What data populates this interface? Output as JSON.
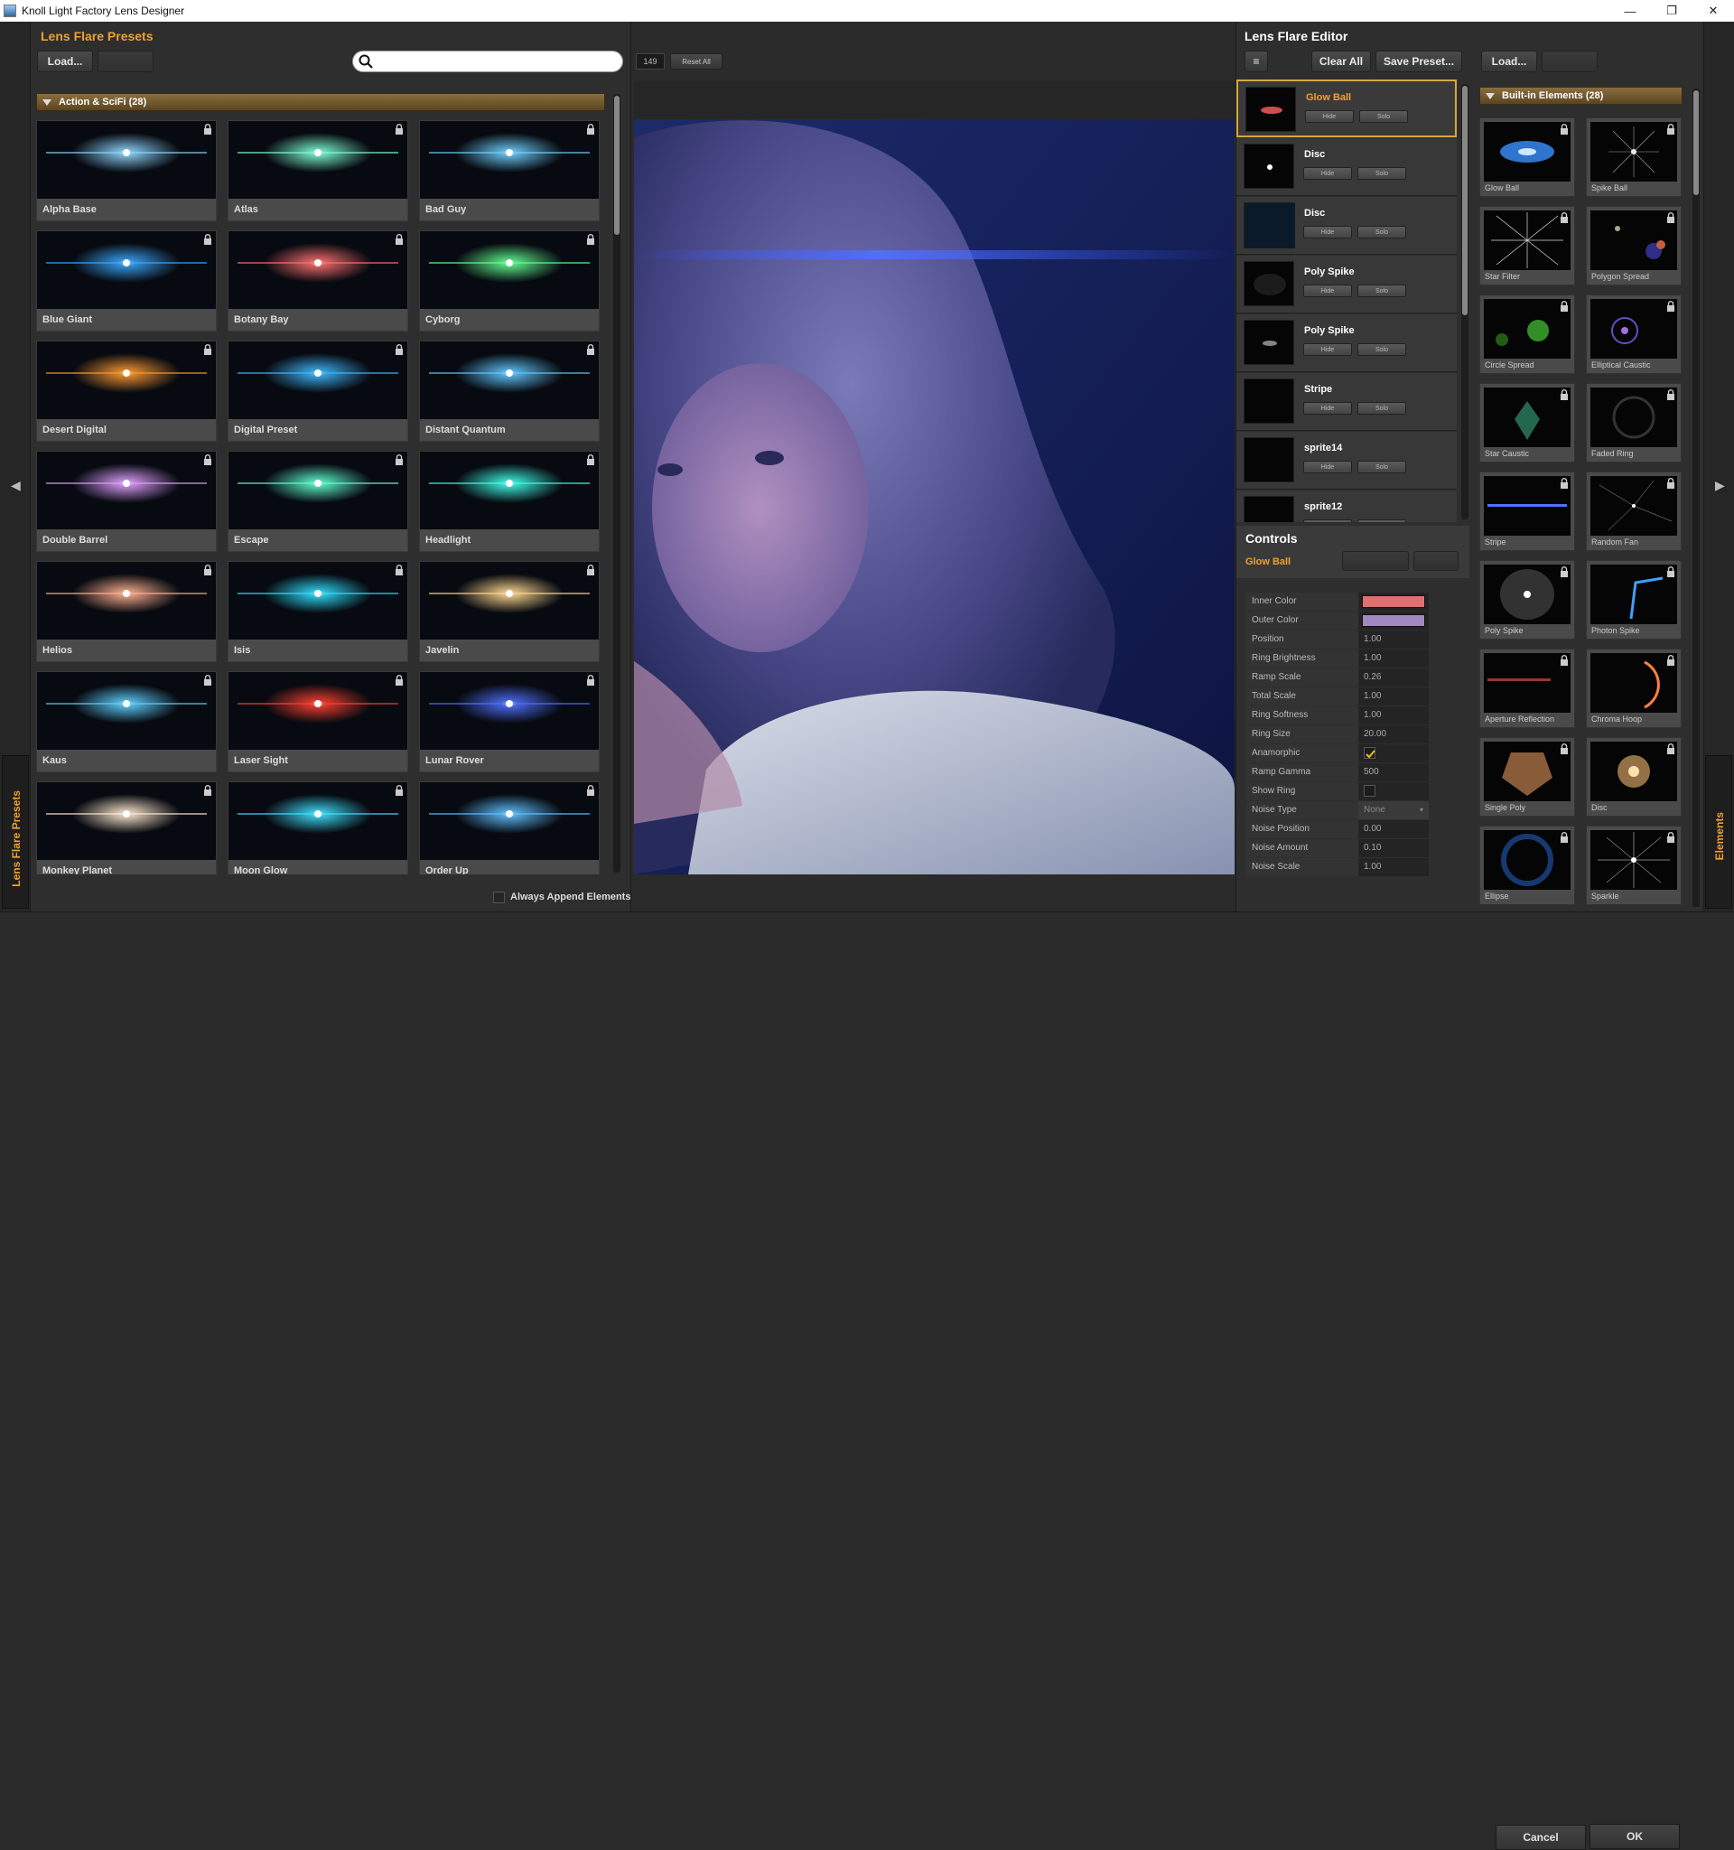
{
  "window": {
    "title": "Knoll Light Factory Lens Designer",
    "minimize": "—",
    "maximize": "❐",
    "close": "✕"
  },
  "left_panel": {
    "title": "Lens Flare Presets",
    "load_label": "Load...",
    "group_label": "Action & SciFi (28)",
    "always_append_label": "Always Append Elements",
    "vertical_tab": "Lens Flare Presets",
    "presets": [
      {
        "name": "Alpha Base",
        "color": "#8fd6ff"
      },
      {
        "name": "Atlas",
        "color": "#7fffd4"
      },
      {
        "name": "Bad Guy",
        "color": "#6fd0ff"
      },
      {
        "name": "Blue Giant",
        "color": "#3aa8ff"
      },
      {
        "name": "Botany Bay",
        "color": "#ff7070"
      },
      {
        "name": "Cyborg",
        "color": "#60ff90"
      },
      {
        "name": "Desert Digital",
        "color": "#ff9a30"
      },
      {
        "name": "Digital Preset",
        "color": "#40b8ff"
      },
      {
        "name": "Distant Quantum",
        "color": "#60c8ff"
      },
      {
        "name": "Double Barrel",
        "color": "#e0a0ff"
      },
      {
        "name": "Escape",
        "color": "#60ffd0"
      },
      {
        "name": "Headlight",
        "color": "#40ffe8"
      },
      {
        "name": "Helios",
        "color": "#ffb090"
      },
      {
        "name": "Isis",
        "color": "#30e0ff"
      },
      {
        "name": "Javelin",
        "color": "#ffd890"
      },
      {
        "name": "Kaus",
        "color": "#60d0ff"
      },
      {
        "name": "Laser Sight",
        "color": "#ff4030"
      },
      {
        "name": "Lunar Rover",
        "color": "#5070ff"
      },
      {
        "name": "Monkey Planet",
        "color": "#ffe8d0"
      },
      {
        "name": "Moon Glow",
        "color": "#40e0ff"
      },
      {
        "name": "Order Up",
        "color": "#60c0ff"
      }
    ]
  },
  "preview": {
    "counter": "149",
    "reset_label": "Reset All"
  },
  "editor": {
    "title": "Lens Flare Editor",
    "menu_icon": "≡",
    "clear_all_label": "Clear All",
    "save_preset_label": "Save Preset...",
    "load_label": "Load...",
    "hide_label": "Hide",
    "solo_label": "Solo",
    "elements": [
      {
        "name": "Glow Ball",
        "selected": true
      },
      {
        "name": "Disc",
        "selected": false
      },
      {
        "name": "Disc",
        "selected": false
      },
      {
        "name": "Poly Spike",
        "selected": false
      },
      {
        "name": "Poly Spike",
        "selected": false
      },
      {
        "name": "Stripe",
        "selected": false
      },
      {
        "name": "sprite14",
        "selected": false
      },
      {
        "name": "sprite12",
        "selected": false
      }
    ],
    "controls_title": "Controls",
    "selected_element": "Glow Ball",
    "controls": [
      {
        "label": "Inner Color",
        "type": "color",
        "value": "#e07070"
      },
      {
        "label": "Outer Color",
        "type": "color",
        "value": "#a088c0"
      },
      {
        "label": "Position",
        "type": "text",
        "value": "1.00"
      },
      {
        "label": "Ring Brightness",
        "type": "text",
        "value": "1.00"
      },
      {
        "label": "Ramp Scale",
        "type": "text",
        "value": "0.26"
      },
      {
        "label": "Total Scale",
        "type": "text",
        "value": "1.00"
      },
      {
        "label": "Ring Softness",
        "type": "text",
        "value": "1.00"
      },
      {
        "label": "Ring Size",
        "type": "text",
        "value": "20.00"
      },
      {
        "label": "Anamorphic",
        "type": "check",
        "value": true
      },
      {
        "label": "Ramp Gamma",
        "type": "text",
        "value": "500"
      },
      {
        "label": "Show Ring",
        "type": "check",
        "value": false
      },
      {
        "label": "Noise Type",
        "type": "select",
        "value": "None"
      },
      {
        "label": "Noise Position",
        "type": "text",
        "value": "0.00"
      },
      {
        "label": "Noise Amount",
        "type": "text",
        "value": "0.10"
      },
      {
        "label": "Noise Scale",
        "type": "text",
        "value": "1.00"
      }
    ]
  },
  "builtin": {
    "group_label": "Built-in Elements (28)",
    "vertical_tab": "Elements",
    "elements": [
      {
        "name": "Glow Ball"
      },
      {
        "name": "Spike Ball"
      },
      {
        "name": "Star Filter"
      },
      {
        "name": "Polygon Spread"
      },
      {
        "name": "Circle Spread"
      },
      {
        "name": "Elliptical Caustic"
      },
      {
        "name": "Star Caustic"
      },
      {
        "name": "Faded Ring"
      },
      {
        "name": "Stripe"
      },
      {
        "name": "Random Fan"
      },
      {
        "name": "Poly Spike"
      },
      {
        "name": "Photon Spike"
      },
      {
        "name": "Aperture Reflection"
      },
      {
        "name": "Chroma Hoop"
      },
      {
        "name": "Single Poly"
      },
      {
        "name": "Disc"
      },
      {
        "name": "Ellipse"
      },
      {
        "name": "Sparkle"
      }
    ]
  },
  "footer": {
    "cancel_label": "Cancel",
    "ok_label": "OK"
  },
  "colors": {
    "accent": "#f0a030",
    "group_bar": "#7a5e30"
  }
}
